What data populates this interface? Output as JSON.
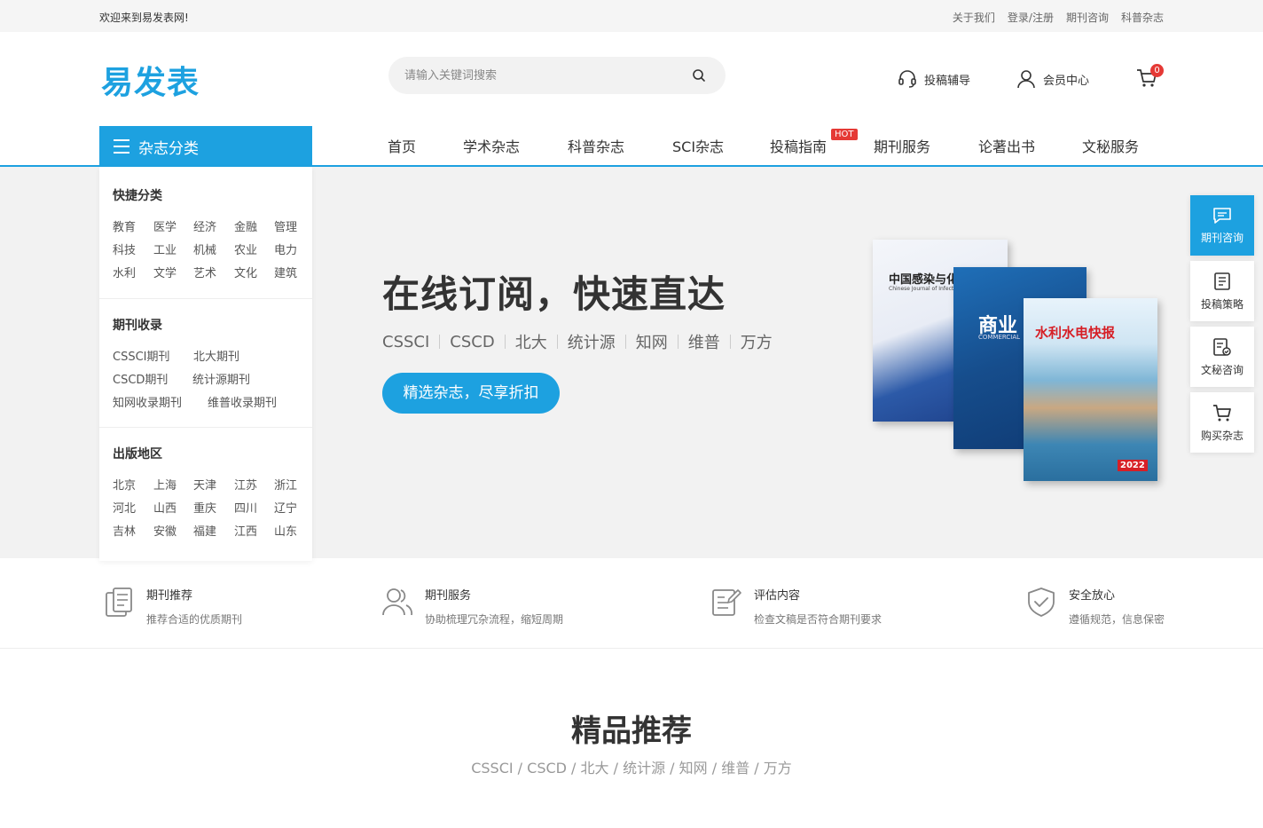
{
  "topbar": {
    "welcome": "欢迎来到易发表网!",
    "links": [
      "关于我们",
      "登录/注册",
      "期刊咨询",
      "科普杂志"
    ]
  },
  "header": {
    "logo": "易发表",
    "search_placeholder": "请输入关键词搜索",
    "guide": "投稿辅导",
    "member": "会员中心",
    "cart_count": "0"
  },
  "nav": {
    "category_button": "杂志分类",
    "items": [
      "首页",
      "学术杂志",
      "科普杂志",
      "SCI杂志",
      "投稿指南",
      "期刊服务",
      "论著出书",
      "文秘服务"
    ],
    "hot_badge": "HOT"
  },
  "sidebar": {
    "quick": {
      "title": "快捷分类",
      "rows": [
        [
          "教育",
          "医学",
          "经济",
          "金融",
          "管理"
        ],
        [
          "科技",
          "工业",
          "机械",
          "农业",
          "电力"
        ],
        [
          "水利",
          "文学",
          "艺术",
          "文化",
          "建筑"
        ]
      ]
    },
    "index": {
      "title": "期刊收录",
      "rows": [
        [
          "CSSCI期刊",
          "北大期刊"
        ],
        [
          "CSCD期刊",
          "统计源期刊"
        ],
        [
          "知网收录期刊",
          "维普收录期刊"
        ]
      ]
    },
    "region": {
      "title": "出版地区",
      "rows": [
        [
          "北京",
          "上海",
          "天津",
          "江苏",
          "浙江"
        ],
        [
          "河北",
          "山西",
          "重庆",
          "四川",
          "辽宁"
        ],
        [
          "吉林",
          "安徽",
          "福建",
          "江西",
          "山东"
        ]
      ]
    }
  },
  "banner": {
    "title": "在线订阅，快速直达",
    "tags": [
      "CSSCI",
      "CSCD",
      "北大",
      "统计源",
      "知网",
      "维普",
      "万方"
    ],
    "button": "精选杂志，尽享折扣",
    "mag1_title": "中国感染与化",
    "mag1_sub": "Chinese Journal of Infection",
    "mag2_title": "商业",
    "mag2_sub": "COMMERCIAL",
    "mag3_title": "水利水电快报",
    "mag3_year": "2022"
  },
  "float": [
    "期刊咨询",
    "投稿策略",
    "文秘咨询",
    "购买杂志"
  ],
  "features": [
    {
      "title": "期刊推荐",
      "desc": "推荐合适的优质期刊"
    },
    {
      "title": "期刊服务",
      "desc": "协助梳理冗杂流程，缩短周期"
    },
    {
      "title": "评估内容",
      "desc": "检查文稿是否符合期刊要求"
    },
    {
      "title": "安全放心",
      "desc": "遵循规范，信息保密"
    }
  ],
  "section": {
    "title": "精品推荐",
    "subtitle": "CSSCI / CSCD / 北大 / 统计源 / 知网 / 维普 / 万方"
  },
  "colors": {
    "accent": "#1da1e0",
    "hot": "#e53935"
  }
}
